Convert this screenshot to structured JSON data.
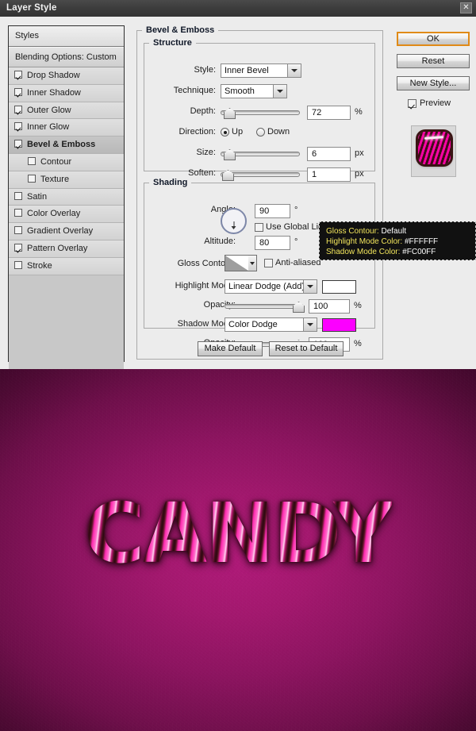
{
  "window": {
    "title": "Layer Style",
    "close_icon": "close-icon"
  },
  "styles_panel": {
    "header": "Styles",
    "blending_options": "Blending Options: Custom",
    "items": [
      {
        "label": "Drop Shadow",
        "checked": true,
        "sub": false,
        "selected": false
      },
      {
        "label": "Inner Shadow",
        "checked": true,
        "sub": false,
        "selected": false
      },
      {
        "label": "Outer Glow",
        "checked": true,
        "sub": false,
        "selected": false
      },
      {
        "label": "Inner Glow",
        "checked": true,
        "sub": false,
        "selected": false
      },
      {
        "label": "Bevel & Emboss",
        "checked": true,
        "sub": false,
        "selected": true
      },
      {
        "label": "Contour",
        "checked": false,
        "sub": true,
        "selected": false
      },
      {
        "label": "Texture",
        "checked": false,
        "sub": true,
        "selected": false
      },
      {
        "label": "Satin",
        "checked": false,
        "sub": false,
        "selected": false
      },
      {
        "label": "Color Overlay",
        "checked": false,
        "sub": false,
        "selected": false
      },
      {
        "label": "Gradient Overlay",
        "checked": false,
        "sub": false,
        "selected": false
      },
      {
        "label": "Pattern Overlay",
        "checked": true,
        "sub": false,
        "selected": false
      },
      {
        "label": "Stroke",
        "checked": false,
        "sub": false,
        "selected": false
      }
    ]
  },
  "panel": {
    "title": "Bevel & Emboss",
    "structure": {
      "title": "Structure",
      "style_label": "Style:",
      "style_value": "Inner Bevel",
      "technique_label": "Technique:",
      "technique_value": "Smooth",
      "depth_label": "Depth:",
      "depth_value": "72",
      "depth_unit": "%",
      "direction_label": "Direction:",
      "direction_up": "Up",
      "direction_down": "Down",
      "direction_selected": "Up",
      "size_label": "Size:",
      "size_value": "6",
      "size_unit": "px",
      "soften_label": "Soften:",
      "soften_value": "1",
      "soften_unit": "px"
    },
    "shading": {
      "title": "Shading",
      "angle_label": "Angle:",
      "angle_value": "90",
      "angle_unit": "°",
      "use_global_light": "Use Global Light",
      "use_global_light_checked": false,
      "altitude_label": "Altitude:",
      "altitude_value": "80",
      "altitude_unit": "°",
      "gloss_contour_label": "Gloss Contour:",
      "anti_aliased": "Anti-aliased",
      "anti_aliased_checked": false,
      "highlight_mode_label": "Highlight Mode:",
      "highlight_mode_value": "Linear Dodge (Add)",
      "highlight_color": "#FFFFFF",
      "highlight_opacity_label": "Opacity:",
      "highlight_opacity_value": "100",
      "highlight_opacity_unit": "%",
      "shadow_mode_label": "Shadow Mode:",
      "shadow_mode_value": "Color Dodge",
      "shadow_color": "#FC00FF",
      "shadow_opacity_label": "Opacity:",
      "shadow_opacity_value": "100",
      "shadow_opacity_unit": "%"
    },
    "make_default": "Make Default",
    "reset_to_default": "Reset to Default"
  },
  "buttons": {
    "ok": "OK",
    "reset": "Reset",
    "new_style": "New Style...",
    "preview": "Preview",
    "preview_checked": true
  },
  "tooltip": {
    "lines": [
      {
        "key": "Gloss Contour:",
        "value": "Default"
      },
      {
        "key": "Highlight Mode Color:",
        "value": "#FFFFFF"
      },
      {
        "key": "Shadow Mode Color:",
        "value": "#FC00FF"
      }
    ]
  },
  "artwork": {
    "text": "CANDY",
    "background_color": "#A3186E"
  }
}
